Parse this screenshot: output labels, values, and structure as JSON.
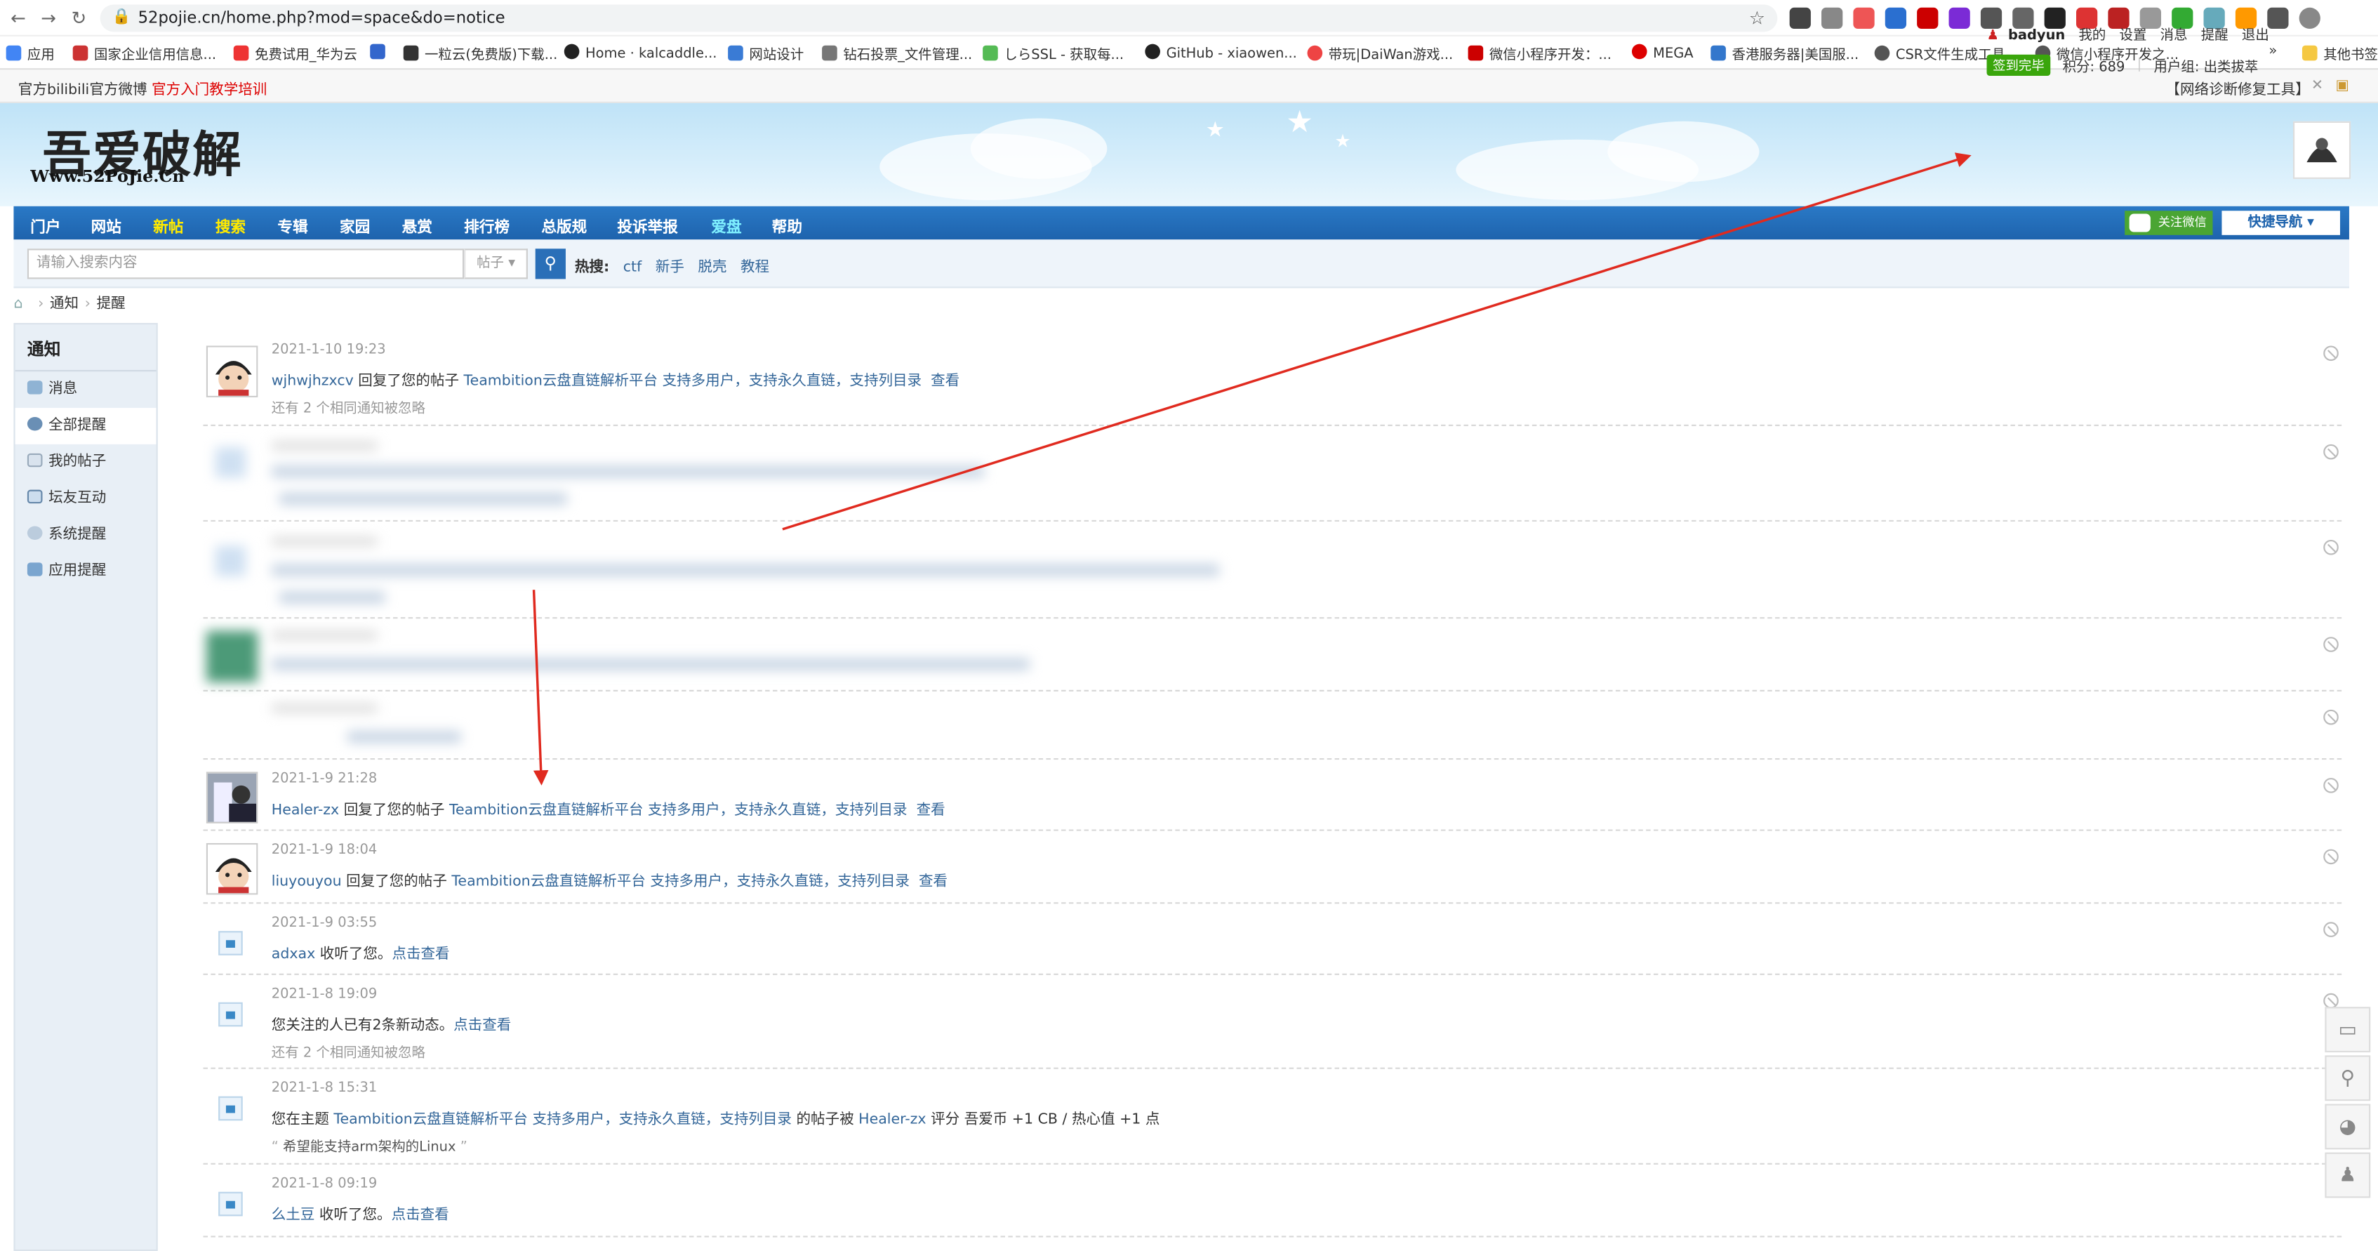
{
  "browser": {
    "url": "52pojie.cn/home.php?mod=space&do=notice",
    "bookmarks": [
      "应用",
      "国家企业信用信息...",
      "免费试用_华为云",
      "一粒云(免费版)下载...",
      "Home · kalcaddle...",
      "网站设计",
      "钻石投票_文件管理...",
      "しらSSL - 获取每...",
      "GitHub - xiaowen...",
      "带玩|DaiWan游戏...",
      "微信小程序开发：...",
      "MEGA",
      "香港服务器|美国服...",
      "CSR文件生成工具-...",
      "微信小程序开发之...",
      "»",
      "其他书签"
    ]
  },
  "topstrip": {
    "left": [
      "官方bilibili",
      "官方微博",
      "官方入门教学培训"
    ],
    "right": "【网络诊断修复工具】"
  },
  "header": {
    "logo_main": "吾爱破解",
    "logo_sub": "Www.52PoJie.Cn",
    "user": {
      "username": "badyun",
      "links": [
        "我的",
        "设置",
        "消息",
        "提醒",
        "退出"
      ],
      "signed": "签到完毕",
      "points": "积分: 689",
      "group": "用户组: 出类拔萃"
    }
  },
  "nav": {
    "items": [
      "门户",
      "网站",
      "新帖",
      "搜索",
      "专辑",
      "家园",
      "悬赏",
      "排行榜",
      "总版规",
      "投诉举报",
      "爱盘",
      "帮助"
    ],
    "wechat": "关注微信",
    "quick_nav": "快捷导航"
  },
  "search": {
    "placeholder": "请输入搜索内容",
    "type": "帖子",
    "hot_label": "热搜:",
    "hot": [
      "ctf",
      "新手",
      "脱壳",
      "教程"
    ]
  },
  "breadcrumb": [
    "通知",
    "提醒"
  ],
  "sidebar": {
    "title": "通知",
    "items": [
      "消息",
      "全部提醒",
      "我的帖子",
      "坛友互动",
      "系统提醒",
      "应用提醒"
    ]
  },
  "notices": [
    {
      "time": "2021-1-10 19:23",
      "user": "wjhwjhzxcv",
      "action": " 回复了您的帖子 ",
      "post": "Teambition云盘直链解析平台 支持多用户，支持永久直链，支持列目录",
      "view": "查看",
      "sub": "还有 2 个相同通知被忽略"
    },
    {
      "time": "2021-1-9 21:28",
      "user": "Healer-zx",
      "action": " 回复了您的帖子 ",
      "post": "Teambition云盘直链解析平台 支持多用户，支持永久直链，支持列目录",
      "view": "查看"
    },
    {
      "time": "2021-1-9 18:04",
      "user": "liuyouyou",
      "action": " 回复了您的帖子 ",
      "post": "Teambition云盘直链解析平台 支持多用户，支持永久直链，支持列目录",
      "view": "查看"
    },
    {
      "time": "2021-1-9 03:55",
      "user": "adxax",
      "action": " 收听了您。",
      "link": "点击查看"
    },
    {
      "time": "2021-1-8 19:09",
      "text": "您关注的人已有2条新动态。",
      "link": "点击查看",
      "sub": "还有 2 个相同通知被忽略"
    },
    {
      "time": "2021-1-8 15:31",
      "prefix": "您在主题 ",
      "post": "Teambition云盘直链解析平台 支持多用户，支持永久直链，支持列目录",
      "mid": " 的帖子被 ",
      "user": "Healer-zx",
      "rate": " 评分 吾爱币 +1 CB / 热心值 +1 点",
      "quote": "希望能支持arm架构的Linux"
    },
    {
      "time": "2021-1-8 09:19",
      "user": "么土豆",
      "action": " 收听了您。",
      "link": "点击查看"
    }
  ],
  "float_tools": [
    "image-icon",
    "search-icon",
    "wechat-icon",
    "user-icon"
  ],
  "colors": {
    "nav": "#1e63ad",
    "link": "#336699",
    "arrow": "#e02a1f",
    "signed": "#3aa60c"
  }
}
